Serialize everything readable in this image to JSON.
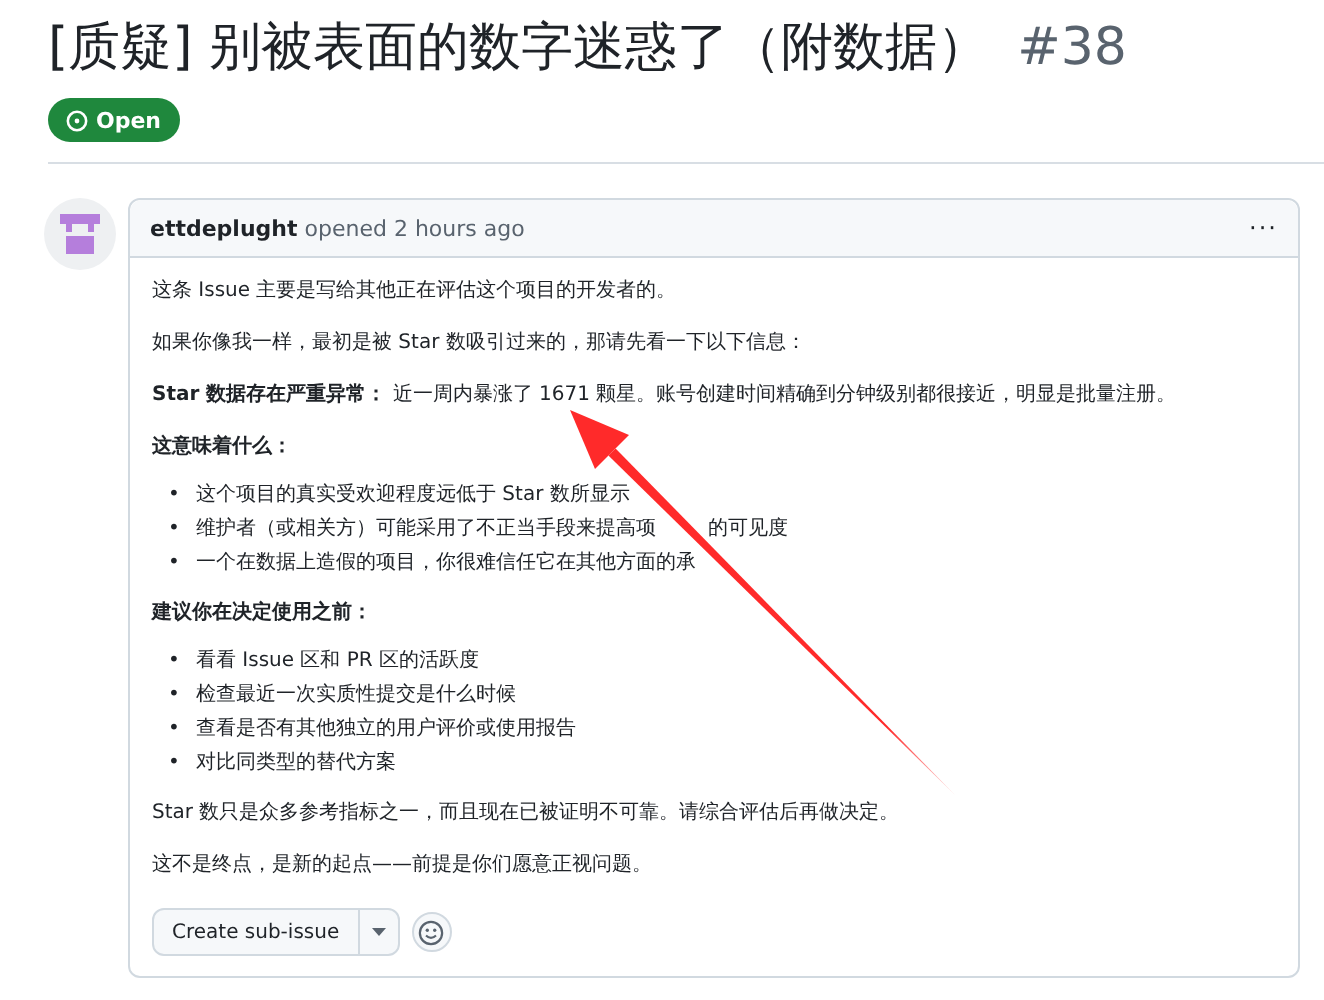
{
  "issue": {
    "title": "[质疑] 别被表面的数字迷惑了（附数据）",
    "number": "#38",
    "status": {
      "label": "Open",
      "kind": "open"
    }
  },
  "comment": {
    "author": "ettdeplught",
    "action": "opened",
    "time": "2 hours ago",
    "menu": "···",
    "body": [
      {
        "kind": "paragraph",
        "text": "这条 Issue 主要是写给其他正在评估这个项目的开发者的。"
      },
      {
        "kind": "paragraph",
        "text": "如果你像我一样，最初是被 Star 数吸引过来的，那请先看一下以下信息："
      },
      {
        "kind": "paragraph",
        "text": "**Star 数据存在严重异常：** 近一周内暴涨了 1671 颗星。账号创建时间精确到分钟级别都很接近，明显是批量注册。"
      },
      {
        "kind": "heading",
        "text": "这意味着什么："
      },
      {
        "kind": "list",
        "marker": "•",
        "items": [
          {
            "text": "这个项目的真实受欢迎程度远低于 Star 数所显示"
          },
          {
            "text": "维护者（或相关方）可能采用了不正当手段来提高项",
            "after": "的可见度"
          },
          {
            "text": "一个在数据上造假的项目，你很难信任它在其他方面的承"
          }
        ]
      },
      {
        "kind": "heading",
        "text": "建议你在决定使用之前："
      },
      {
        "kind": "list",
        "marker": "•",
        "items": [
          {
            "text": "看看 Issue 区和 PR 区的活跃度"
          },
          {
            "text": "检查最近一次实质性提交是什么时候"
          },
          {
            "text": "查看是否有其他独立的用户评价或使用报告"
          },
          {
            "text": "对比同类型的替代方案"
          }
        ]
      },
      {
        "kind": "paragraph",
        "text": "Star 数只是众多参考指标之一，而且现在已被证明不可靠。请综合评估后再做决定。"
      },
      {
        "kind": "paragraph",
        "text": "这不是终点，是新的起点——前提是你们愿意正视问题。"
      }
    ],
    "button": "Create sub-issue"
  }
}
